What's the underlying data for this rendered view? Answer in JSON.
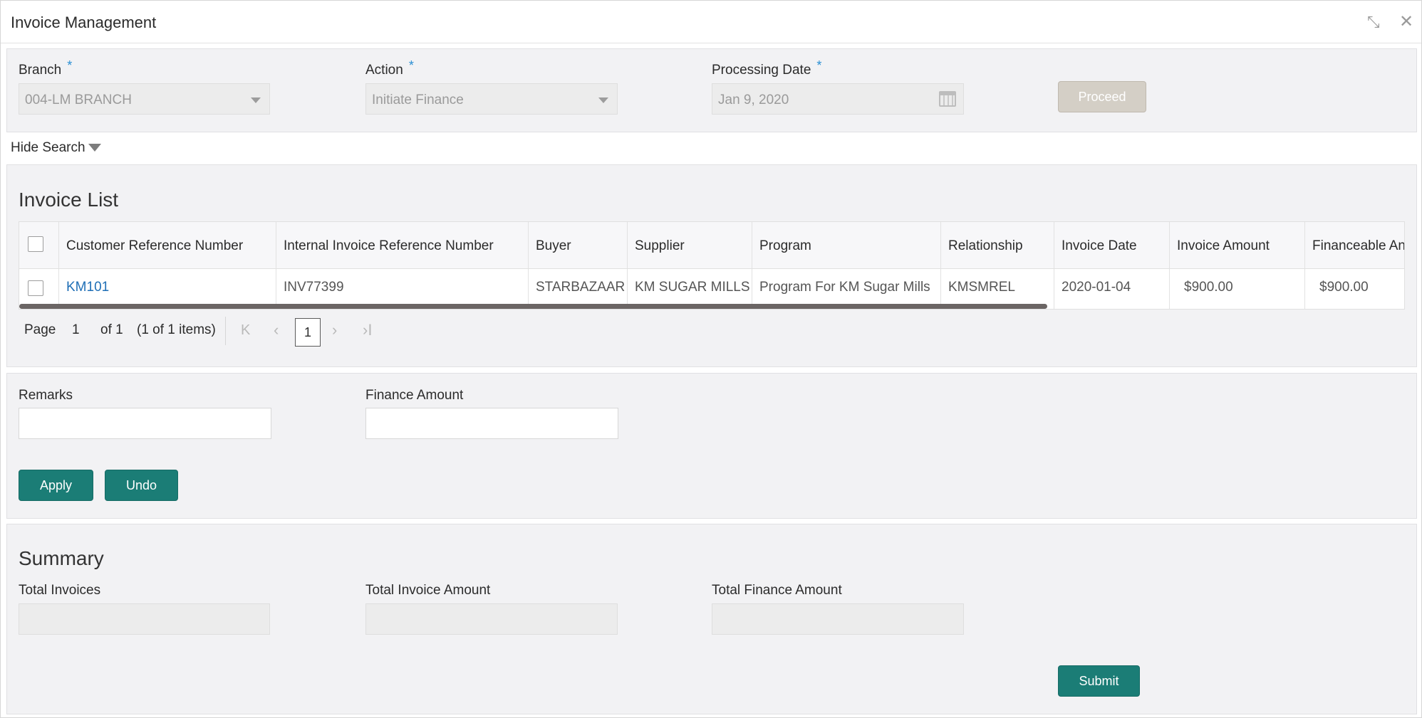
{
  "window": {
    "title": "Invoice Management",
    "minimize_icon": "⤡",
    "close_icon": "✕"
  },
  "criteria": {
    "branch_label": "Branch",
    "branch_value": "004-LM BRANCH",
    "action_label": "Action",
    "action_value": "Initiate Finance",
    "date_label": "Processing Date",
    "date_value": "Jan 9, 2020",
    "required_mark": "*",
    "proceed_label": "Proceed"
  },
  "toggle": {
    "hide_search_label": "Hide Search"
  },
  "invoice_list": {
    "title": "Invoice List",
    "columns": [
      "Customer Reference Number",
      "Internal Invoice Reference Number",
      "Buyer",
      "Supplier",
      "Program",
      "Relationship",
      "Invoice Date",
      "Invoice Amount",
      "Financeable An"
    ],
    "rows": [
      {
        "customer_ref": "KM101",
        "internal_ref": "INV77399",
        "buyer": "STARBAZAAR",
        "supplier": "KM SUGAR MILLS",
        "program": "Program For KM Sugar Mills",
        "relationship": "KMSMREL",
        "invoice_date": "2020-01-04",
        "invoice_amount": "$900.00",
        "financeable_amount": "$900.00"
      }
    ]
  },
  "pager": {
    "page_label": "Page",
    "current_page": "1",
    "of_label": "of 1",
    "items_label": "(1 of 1 items)",
    "first_icon": "K",
    "prev_icon": "‹",
    "next_icon": "›",
    "last_icon": "›I"
  },
  "remarks": {
    "remarks_label": "Remarks",
    "remarks_value": "",
    "finance_amount_label": "Finance Amount",
    "finance_amount_value": "",
    "apply_label": "Apply",
    "undo_label": "Undo"
  },
  "summary": {
    "title": "Summary",
    "total_invoices_label": "Total Invoices",
    "total_invoices_value": "",
    "total_invoice_amount_label": "Total Invoice Amount",
    "total_invoice_amount_value": "",
    "total_finance_amount_label": "Total Finance Amount",
    "total_finance_amount_value": "",
    "submit_label": "Submit"
  },
  "colors": {
    "primary_button": "#1b7d76",
    "disabled_button": "#d4cfc6",
    "link": "#1f6fb6",
    "required": "#2a8fd3"
  }
}
